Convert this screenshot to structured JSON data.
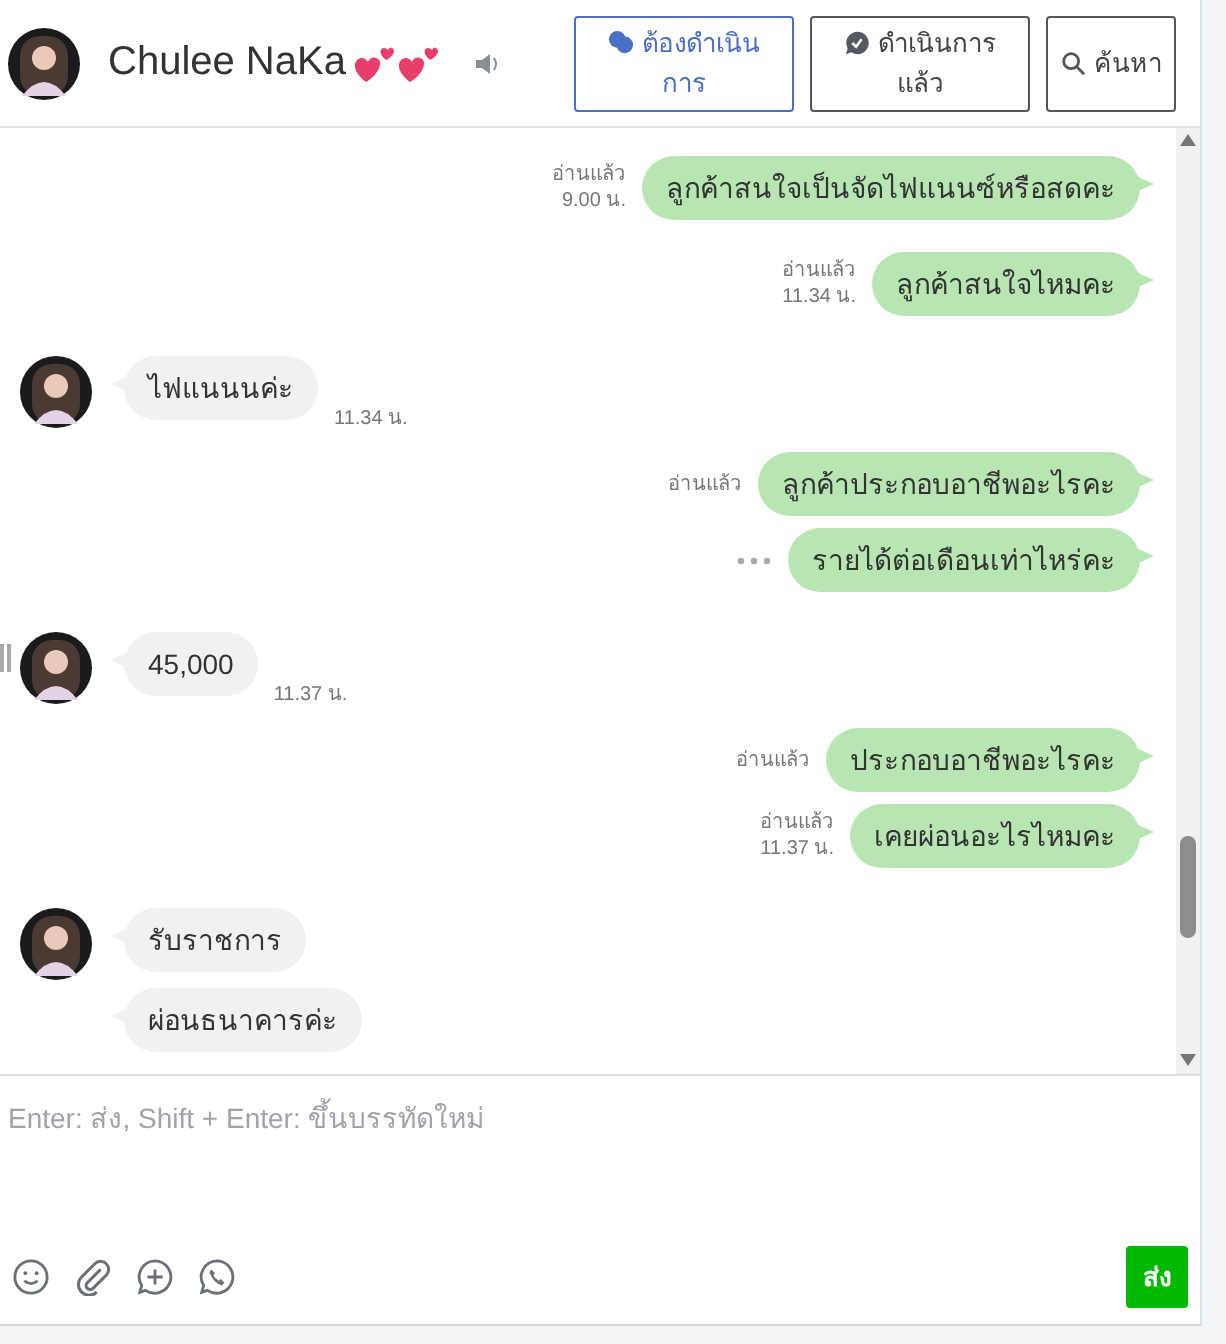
{
  "header": {
    "name": "Chulee NaKa",
    "buttons": [
      {
        "label": "ต้องดำเนินการ",
        "selected": true
      },
      {
        "label": "ดำเนินการแล้ว",
        "selected": false
      },
      {
        "label": "ค้นหา",
        "selected": false
      }
    ]
  },
  "messages": [
    {
      "kind": "sent",
      "text": "ลูกค้าสนใจเป็นจัดไฟแนนซ์หรือสดคะ",
      "read": "อ่านแล้ว",
      "time": "9.00 น.",
      "sending": false
    },
    {
      "kind": "sent",
      "text": "ลูกค้าสนใจไหมคะ",
      "read": "อ่านแล้ว",
      "time": "11.34 น.",
      "sending": false
    },
    {
      "kind": "received",
      "text": "ไฟแนนนค่ะ",
      "time": "11.34 น.",
      "avatar": true
    },
    {
      "kind": "sent",
      "text": "ลูกค้าประกอบอาชีพอะไรคะ",
      "read": "อ่านแล้ว",
      "sending": false
    },
    {
      "kind": "sent",
      "text": "รายได้ต่อเดือนเท่าไหร่คะ",
      "sending": true
    },
    {
      "kind": "received",
      "text": "45,000",
      "time": "11.37 น.",
      "avatar": true
    },
    {
      "kind": "sent",
      "text": "ประกอบอาชีพอะไรคะ",
      "read": "อ่านแล้ว",
      "sending": false
    },
    {
      "kind": "sent",
      "text": "เคยผ่อนอะไรไหมคะ",
      "read": "อ่านแล้ว",
      "time": "11.37 น.",
      "sending": false
    },
    {
      "kind": "received",
      "text": "รับราชการ",
      "avatar": true
    },
    {
      "kind": "received",
      "text": "ผ่อนธนาคารค่ะ",
      "avatar": false
    }
  ],
  "composer": {
    "placeholder": "Enter: ส่ง, Shift + Enter: ขึ้นบรรทัดใหม่",
    "send": "ส่ง"
  }
}
